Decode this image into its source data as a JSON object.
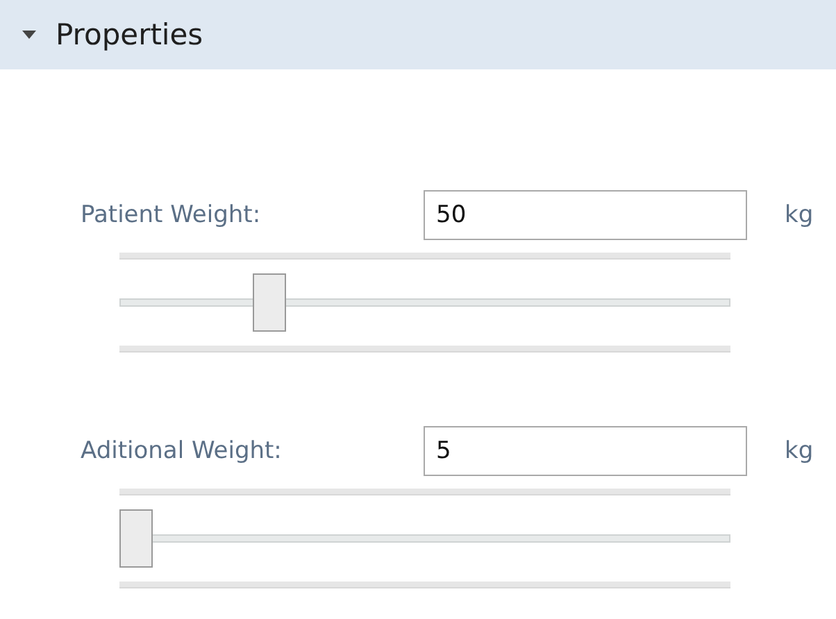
{
  "section": {
    "title": "Properties",
    "expanded": true
  },
  "fields": [
    {
      "label": "Patient Weight:",
      "value": "50",
      "unit": "kg",
      "level": 0.23
    },
    {
      "label": "Aditional Weight:",
      "value": "5",
      "unit": "kg",
      "level": 0
    }
  ]
}
